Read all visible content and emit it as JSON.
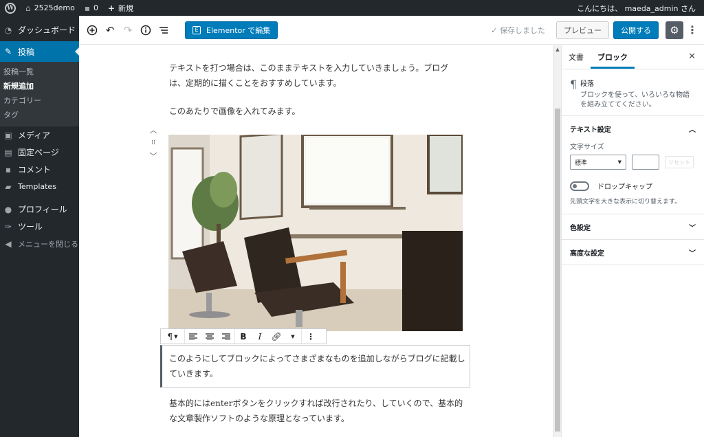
{
  "admin_bar": {
    "site_name": "2525demo",
    "comment_count": "0",
    "new_label": "新規",
    "greeting": "こんにちは、 maeda_admin さん"
  },
  "sidebar": {
    "items": [
      {
        "label": "ダッシュボード",
        "icon": "dashboard-icon"
      },
      {
        "label": "投稿",
        "icon": "pin-icon"
      },
      {
        "label": "メディア",
        "icon": "media-icon"
      },
      {
        "label": "固定ページ",
        "icon": "pages-icon"
      },
      {
        "label": "コメント",
        "icon": "comment-icon"
      },
      {
        "label": "Templates",
        "icon": "folder-icon"
      },
      {
        "label": "プロフィール",
        "icon": "user-icon"
      },
      {
        "label": "ツール",
        "icon": "wrench-icon"
      }
    ],
    "submenu": [
      "投稿一覧",
      "新規追加",
      "カテゴリー",
      "タグ"
    ],
    "collapse_label": "メニューを閉じる"
  },
  "header": {
    "elementor_label": "Elementor で編集",
    "saved_label": "保存しました",
    "preview_label": "プレビュー",
    "publish_label": "公開する"
  },
  "content": {
    "para1": "テキストを打つ場合は、このままテキストを入力していきましょう。ブログは、定期的に描くことをおすすめしています。",
    "para2": "このあたりで画像を入れてみます。",
    "para3": "このようにしてブロックによってさまざまなものを追加しながらブログに記載していきます。",
    "para4": "基本的にはenterボタンをクリックすれば改行されたり、していくので、基本的な文章製作ソフトのような原理となっています。"
  },
  "block_toolbar": {
    "bold": "B",
    "italic": "I"
  },
  "panel": {
    "tab_document": "文書",
    "tab_block": "ブロック",
    "block_title": "段落",
    "block_desc": "ブロックを使って、いろいろな物語を組み立ててください。",
    "text_settings": "テキスト設定",
    "font_size_label": "文字サイズ",
    "font_size_value": "標準",
    "reset_label": "リセット",
    "dropcap_label": "ドロップキャップ",
    "dropcap_help": "先頭文字を大きな表示に切り替えます。",
    "color_settings": "色設定",
    "advanced_settings": "高度な設定"
  },
  "colors": {
    "admin_dark": "#23282d",
    "accent_blue": "#007cba"
  }
}
